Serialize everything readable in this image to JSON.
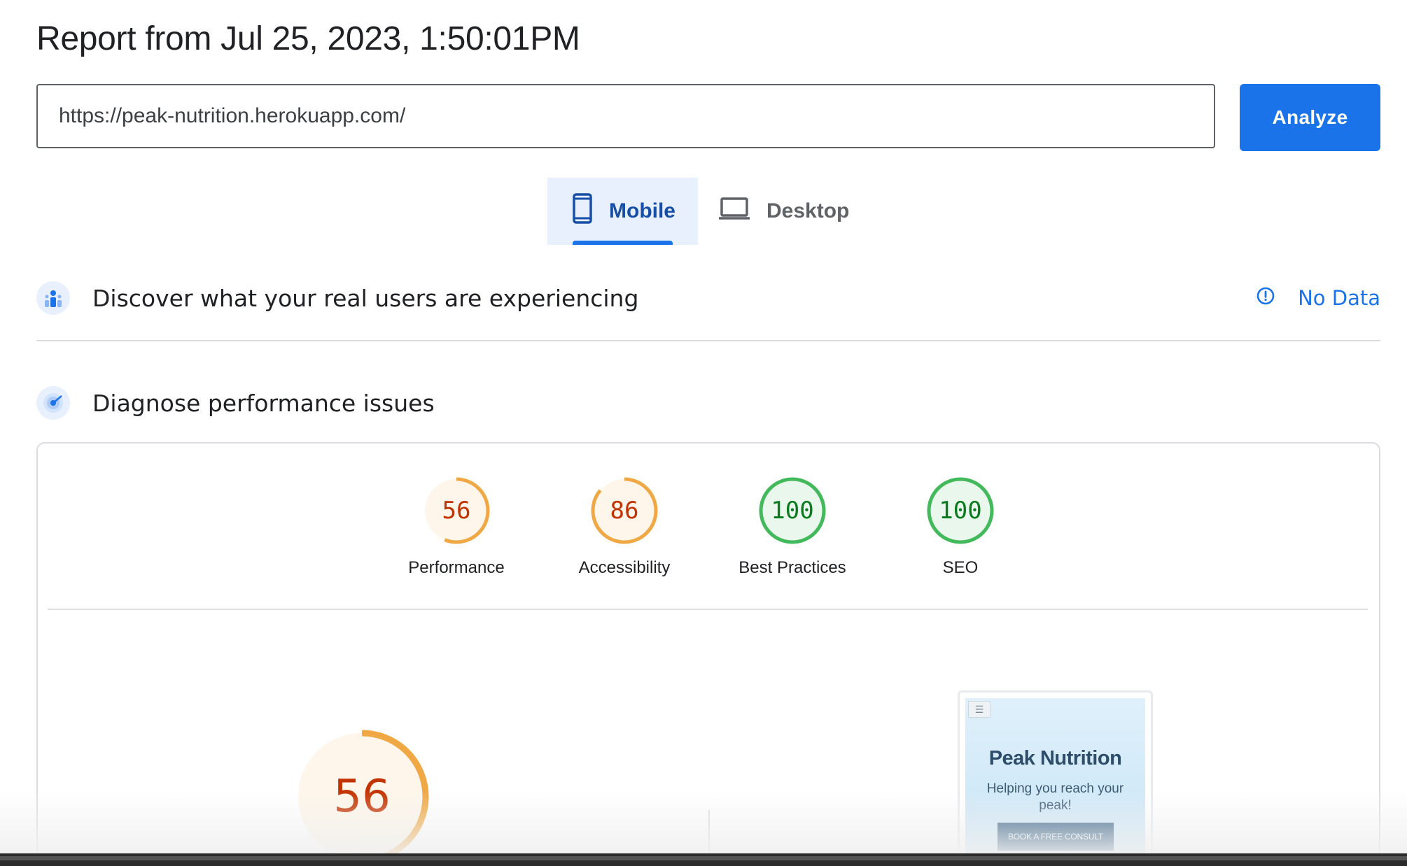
{
  "report": {
    "title": "Report from Jul 25, 2023, 1:50:01PM"
  },
  "search": {
    "url_value": "https://peak-nutrition.herokuapp.com/",
    "analyze_label": "Analyze"
  },
  "tabs": [
    {
      "label": "Mobile",
      "icon": "smartphone-icon",
      "active": true
    },
    {
      "label": "Desktop",
      "icon": "laptop-icon",
      "active": false
    }
  ],
  "field_data": {
    "title": "Discover what your real users are experiencing",
    "icon": "users-icon",
    "status_icon": "info-circle-icon",
    "status_label": "No Data"
  },
  "lab_data": {
    "title": "Diagnose performance issues",
    "icon": "radar-icon"
  },
  "scores": [
    {
      "name": "Performance",
      "value": "56",
      "rating": "average"
    },
    {
      "name": "Accessibility",
      "value": "86",
      "rating": "average"
    },
    {
      "name": "Best Practices",
      "value": "100",
      "rating": "pass"
    },
    {
      "name": "SEO",
      "value": "100",
      "rating": "pass"
    }
  ],
  "main_score": {
    "value": "56",
    "rating": "average"
  },
  "preview": {
    "menu_icon": "hamburger-icon",
    "site_title": "Peak Nutrition",
    "tagline": "Helping you reach your peak!",
    "cta_label": "BOOK A FREE CONSULT"
  },
  "colors": {
    "accent": "#1a73e8",
    "average_stroke": "#f0a844",
    "average_text": "#c33300",
    "average_fill": "#fef6ea",
    "pass_stroke": "#42b95a",
    "pass_text": "#0b7a1e",
    "pass_fill": "#e9f7ec"
  }
}
